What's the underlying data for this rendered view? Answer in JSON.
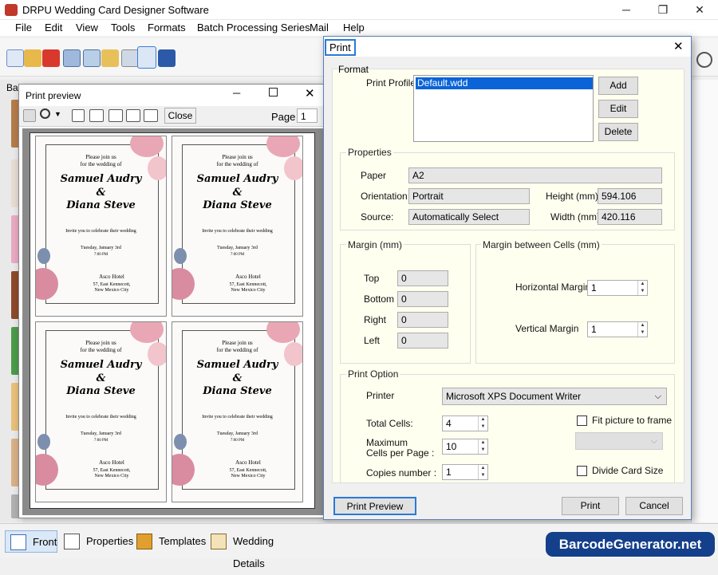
{
  "app": {
    "title": "DRPU Wedding Card Designer Software",
    "menu": [
      "File",
      "Edit",
      "View",
      "Tools",
      "Formats",
      "Batch Processing Series",
      "Mail",
      "Help"
    ],
    "window_controls": [
      "─",
      "❐",
      "✕"
    ]
  },
  "bottom_tabs": [
    "Front",
    "Properties",
    "Templates",
    "Wedding Details"
  ],
  "brand": "BarcodeGenerator.net",
  "side_label": "Ba",
  "preview": {
    "title": "Print preview",
    "close_label": "Close",
    "page_label": "Page",
    "page_value": "1",
    "card": {
      "line1": "Please join us",
      "line2": "for the wedding of",
      "name1": "Samuel Audry",
      "amp": "&",
      "name2": "Diana Steve",
      "invite": "Invite you to celebrate their wedding",
      "date": "Tuesday, January 3rd",
      "time": "7:00 PM",
      "venue": "Asco Hotel",
      "addr1": "57, East Kennecott,",
      "addr2": "New Mexico City"
    }
  },
  "dialog": {
    "title": "Print",
    "format_label": "Format",
    "print_profile_label": "Print Profile",
    "profiles": [
      "Default.wdd"
    ],
    "add_label": "Add",
    "edit_label": "Edit",
    "delete_label": "Delete",
    "properties_label": "Properties",
    "paper_label": "Paper",
    "paper_value": "A2",
    "orientation_label": "Orientation",
    "orientation_value": "Portrait",
    "height_label": "Height (mm)",
    "height_value": "594.106",
    "source_label": "Source:",
    "source_value": "Automatically Select",
    "width_label": "Width (mm)",
    "width_value": "420.116",
    "margin_label": "Margin (mm)",
    "top_label": "Top",
    "top_value": "0",
    "bottom_label": "Bottom",
    "bottom_value": "0",
    "right_label": "Right",
    "right_value": "0",
    "left_label": "Left",
    "left_value": "0",
    "margin_cells_label": "Margin between Cells (mm)",
    "hmargin_label": "Horizontal Margin",
    "hmargin_value": "1",
    "vmargin_label": "Vertical Margin",
    "vmargin_value": "1",
    "print_option_label": "Print Option",
    "printer_label": "Printer",
    "printer_value": "Microsoft XPS Document Writer",
    "total_cells_label": "Total Cells:",
    "total_cells_value": "4",
    "fit_label": "Fit picture to frame",
    "max_cells_label1": "Maximum",
    "max_cells_label2": "Cells per Page :",
    "max_cells_value": "10",
    "copies_label": "Copies number :",
    "copies_value": "1",
    "divide_label": "Divide Card Size",
    "print_preview_label": "Print Preview",
    "print_label": "Print",
    "cancel_label": "Cancel"
  }
}
